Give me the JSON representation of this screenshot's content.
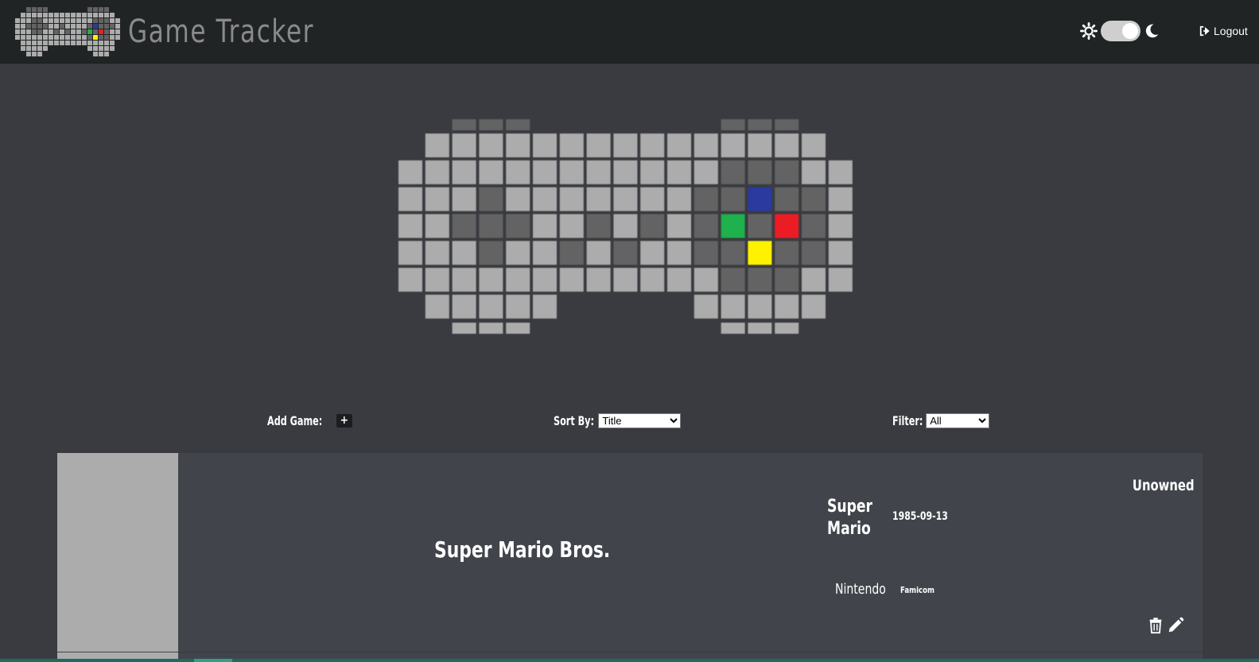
{
  "app": {
    "title": "Game Tracker",
    "logout_label": "Logout",
    "theme": "dark"
  },
  "colors": {
    "navbar_bg": "#212425",
    "page_bg": "#393b41",
    "card_bg": "#41454b",
    "pixel_light": "#acacac",
    "pixel_dark": "#636363",
    "button_blue": "#2a3a9e",
    "button_green": "#1fb14b",
    "button_red": "#ec1c24",
    "button_yellow": "#fff200"
  },
  "icons": {
    "theme_light": "sun-icon",
    "theme_dark": "moon-icon",
    "logout": "logout-icon",
    "delete": "trash-icon",
    "edit": "pencil-icon"
  },
  "controls": {
    "add_label": "Add Game:",
    "add_button": "+",
    "sort_label": "Sort By:",
    "sort_selected": "Title",
    "filter_label": "Filter:",
    "filter_selected": "All"
  },
  "games": [
    {
      "title": "Super Mario Bros.",
      "series": "Super Mario",
      "release_date": "1985-09-13",
      "developer": "Nintendo",
      "platform": "Famicom",
      "status": "Unowned"
    }
  ]
}
